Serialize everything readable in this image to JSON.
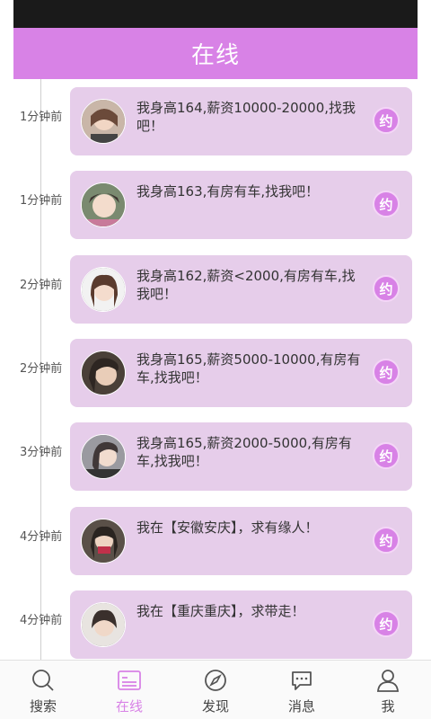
{
  "header": {
    "title": "在线"
  },
  "actions": {
    "date_label": "约"
  },
  "feed": [
    {
      "time": "1分钟前",
      "message": "我身高164,薪资10000-20000,找我吧！",
      "avatar_color": "#6b4a3a"
    },
    {
      "time": "1分钟前",
      "message": "我身高163,有房有车,找我吧！",
      "avatar_color": "#3d3430"
    },
    {
      "time": "2分钟前",
      "message": "我身高162,薪资<2000,有房有车,找我吧！",
      "avatar_color": "#5a3b2e"
    },
    {
      "time": "2分钟前",
      "message": "我身高165,薪资5000-10000,有房有车,找我吧！",
      "avatar_color": "#2e2622"
    },
    {
      "time": "3分钟前",
      "message": "我身高165,薪资2000-5000,有房有车,找我吧！",
      "avatar_color": "#403838"
    },
    {
      "time": "4分钟前",
      "message": "我在【安徽安庆】，求有缘人！",
      "avatar_color": "#2a2420"
    },
    {
      "time": "4分钟前",
      "message": "我在【重庆重庆】，求带走！",
      "avatar_color": "#3a302c"
    }
  ],
  "tabs": [
    {
      "label": "搜索",
      "icon": "search-icon",
      "active": false
    },
    {
      "label": "在线",
      "icon": "list-icon",
      "active": true
    },
    {
      "label": "发现",
      "icon": "compass-icon",
      "active": false
    },
    {
      "label": "消息",
      "icon": "chat-bubble-icon",
      "active": false
    },
    {
      "label": "我",
      "icon": "person-icon",
      "active": false
    }
  ],
  "colors": {
    "accent": "#d882e6",
    "card": "#e6cdea",
    "statusbar": "#1a1a1a"
  }
}
